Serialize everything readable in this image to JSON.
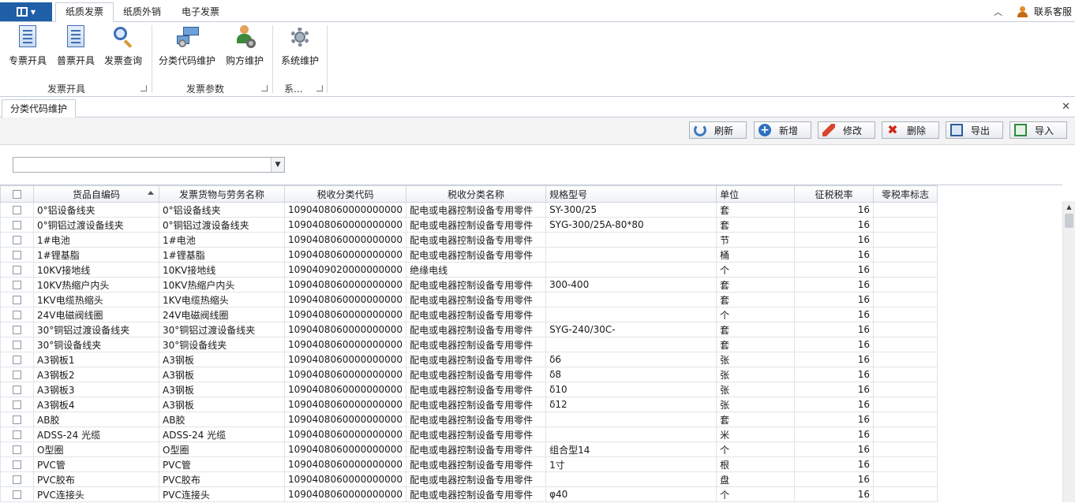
{
  "ribbon_tabs": [
    "纸质发票",
    "纸质外销",
    "电子发票"
  ],
  "top_right": {
    "contact_label": "联系客服"
  },
  "ribbon_groups": [
    {
      "label": "发票开具",
      "buttons": [
        "专票开具",
        "普票开具",
        "发票查询"
      ]
    },
    {
      "label": "发票参数",
      "buttons": [
        "分类代码维护",
        "购方维护"
      ]
    },
    {
      "label": "系...",
      "buttons": [
        "系统维护"
      ]
    }
  ],
  "doc_tab": {
    "label": "分类代码维护"
  },
  "toolbar": {
    "refresh": "刷新",
    "add": "新增",
    "edit": "修改",
    "delete": "删除",
    "export": "导出",
    "import": "导入"
  },
  "filter": {
    "value": ""
  },
  "columns": [
    "货品自编码",
    "发票货物与劳务名称",
    "税收分类代码",
    "税收分类名称",
    "规格型号",
    "单位",
    "征税税率",
    "零税率标志"
  ],
  "rows": [
    [
      "0°铝设备线夹",
      "0°铝设备线夹",
      "1090408060000000000",
      "配电或电器控制设备专用零件",
      "SY-300/25",
      "套",
      "16",
      ""
    ],
    [
      "0°铜铝过渡设备线夹",
      "0°铜铝过渡设备线夹",
      "1090408060000000000",
      "配电或电器控制设备专用零件",
      "SYG-300/25A-80*80",
      "套",
      "16",
      ""
    ],
    [
      "1#电池",
      "1#电池",
      "1090408060000000000",
      "配电或电器控制设备专用零件",
      "",
      "节",
      "16",
      ""
    ],
    [
      "1#锂基脂",
      "1#锂基脂",
      "1090408060000000000",
      "配电或电器控制设备专用零件",
      "",
      "桶",
      "16",
      ""
    ],
    [
      "10KV接地线",
      "10KV接地线",
      "1090409020000000000",
      "绝缘电线",
      "",
      "个",
      "16",
      ""
    ],
    [
      "10KV热缩户内头",
      "10KV热缩户内头",
      "1090408060000000000",
      "配电或电器控制设备专用零件",
      "300-400",
      "套",
      "16",
      ""
    ],
    [
      "1KV电缆热缩头",
      "1KV电缆热缩头",
      "1090408060000000000",
      "配电或电器控制设备专用零件",
      "",
      "套",
      "16",
      ""
    ],
    [
      "24V电磁阀线圈",
      "24V电磁阀线圈",
      "1090408060000000000",
      "配电或电器控制设备专用零件",
      "",
      "个",
      "16",
      ""
    ],
    [
      "30°铜铝过渡设备线夹",
      "30°铜铝过渡设备线夹",
      "1090408060000000000",
      "配电或电器控制设备专用零件",
      "SYG-240/30C-",
      "套",
      "16",
      ""
    ],
    [
      "30°铜设备线夹",
      "30°铜设备线夹",
      "1090408060000000000",
      "配电或电器控制设备专用零件",
      "",
      "套",
      "16",
      ""
    ],
    [
      "A3钢板1",
      "A3钢板",
      "1090408060000000000",
      "配电或电器控制设备专用零件",
      "δ6",
      "张",
      "16",
      ""
    ],
    [
      "A3钢板2",
      "A3钢板",
      "1090408060000000000",
      "配电或电器控制设备专用零件",
      "δ8",
      "张",
      "16",
      ""
    ],
    [
      "A3钢板3",
      "A3钢板",
      "1090408060000000000",
      "配电或电器控制设备专用零件",
      "δ10",
      "张",
      "16",
      ""
    ],
    [
      "A3钢板4",
      "A3钢板",
      "1090408060000000000",
      "配电或电器控制设备专用零件",
      "δ12",
      "张",
      "16",
      ""
    ],
    [
      "AB胶",
      "AB胶",
      "1090408060000000000",
      "配电或电器控制设备专用零件",
      "",
      "套",
      "16",
      ""
    ],
    [
      "ADSS-24 光缆",
      "ADSS-24 光缆",
      "1090408060000000000",
      "配电或电器控制设备专用零件",
      "",
      "米",
      "16",
      ""
    ],
    [
      "O型圈",
      "O型圈",
      "1090408060000000000",
      "配电或电器控制设备专用零件",
      "组合型14",
      "个",
      "16",
      ""
    ],
    [
      "PVC管",
      "PVC管",
      "1090408060000000000",
      "配电或电器控制设备专用零件",
      "1寸",
      "根",
      "16",
      ""
    ],
    [
      "PVC胶布",
      "PVC胶布",
      "1090408060000000000",
      "配电或电器控制设备专用零件",
      "",
      "盘",
      "16",
      ""
    ],
    [
      "PVC连接头",
      "PVC连接头",
      "1090408060000000000",
      "配电或电器控制设备专用零件",
      "φ40",
      "个",
      "16",
      ""
    ]
  ]
}
